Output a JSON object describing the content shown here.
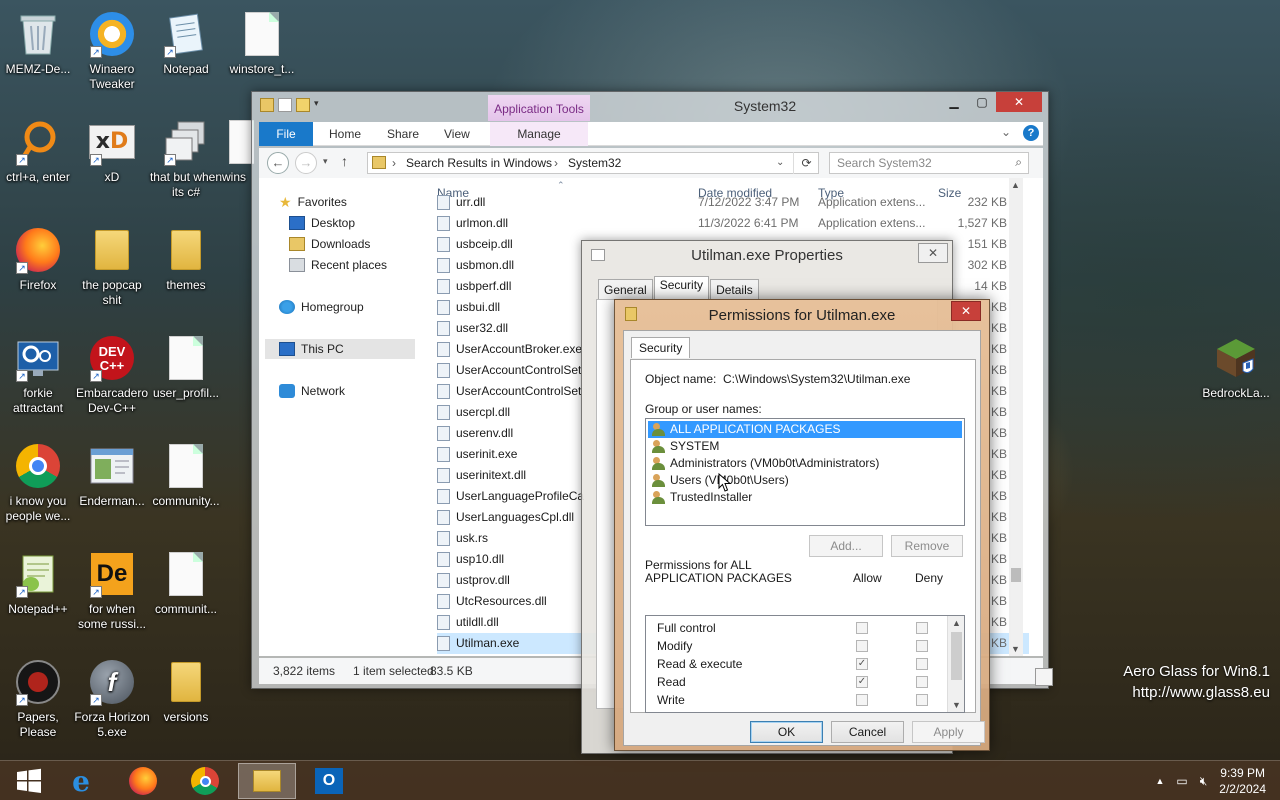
{
  "desktop": {
    "icons": [
      {
        "label": "MEMZ-De...",
        "icon": "recycle-bin-icon"
      },
      {
        "label": "Winaero Tweaker",
        "icon": "winaero-icon"
      },
      {
        "label": "Notepad",
        "icon": "notepad-icon"
      },
      {
        "label": "winstore_t...",
        "icon": "file-icon"
      },
      {
        "label": "ctrl+a, enter",
        "icon": "orange-ring-icon"
      },
      {
        "label": "xD",
        "icon": "xd-icon"
      },
      {
        "label": "that but when its c#",
        "icon": "windows-stack-icon"
      },
      {
        "label": "wins",
        "icon": "file-icon"
      },
      {
        "label": "Firefox",
        "icon": "firefox-icon"
      },
      {
        "label": "the popcap shit",
        "icon": "folder-icon"
      },
      {
        "label": "themes",
        "icon": "folder-icon"
      },
      {
        "label": "forkie attractant",
        "icon": "settings-monitor-icon"
      },
      {
        "label": "Embarcadero Dev-C++",
        "icon": "devcpp-icon"
      },
      {
        "label": "user_profil...",
        "icon": "file-icon"
      },
      {
        "label": "i know you people we...",
        "icon": "chrome-icon"
      },
      {
        "label": "Enderman...",
        "icon": "window-icon"
      },
      {
        "label": "community...",
        "icon": "file-icon"
      },
      {
        "label": "Notepad++",
        "icon": "notepadpp-icon"
      },
      {
        "label": "for when some russi...",
        "icon": "de-icon"
      },
      {
        "label": "communit...",
        "icon": "file-icon"
      },
      {
        "label": "Papers, Please",
        "icon": "papers-please-icon"
      },
      {
        "label": "Forza Horizon 5.exe",
        "icon": "flash-icon"
      },
      {
        "label": "versions",
        "icon": "folder-icon"
      },
      {
        "label": "BedrockLa...",
        "icon": "minecraft-icon"
      }
    ]
  },
  "explorer": {
    "title": "System32",
    "contextual_tab": "Application Tools",
    "tabs": [
      "File",
      "Home",
      "Share",
      "View",
      "Manage"
    ],
    "breadcrumb": [
      "Search Results in Windows",
      "System32"
    ],
    "search_placeholder": "Search System32",
    "nav": {
      "favorites": "Favorites",
      "desktop": "Desktop",
      "downloads": "Downloads",
      "recent": "Recent places",
      "homegroup": "Homegroup",
      "thispc": "This PC",
      "network": "Network"
    },
    "columns": {
      "name": "Name",
      "date": "Date modified",
      "type": "Type",
      "size": "Size"
    },
    "files": [
      {
        "name": "urr.dll",
        "date": "7/12/2022 3:47 PM",
        "type": "Application extens...",
        "size": "232 KB"
      },
      {
        "name": "urlmon.dll",
        "date": "11/3/2022 6:41 PM",
        "type": "Application extens...",
        "size": "1,527 KB"
      },
      {
        "name": "usbceip.dll",
        "date": "",
        "type": "",
        "size": "151 KB"
      },
      {
        "name": "usbmon.dll",
        "date": "",
        "type": "",
        "size": "302 KB"
      },
      {
        "name": "usbperf.dll",
        "date": "",
        "type": "",
        "size": "14 KB"
      },
      {
        "name": "usbui.dll",
        "date": "",
        "type": "",
        "size": "KB"
      },
      {
        "name": "user32.dll",
        "date": "",
        "type": "",
        "size": "KB"
      },
      {
        "name": "UserAccountBroker.exe",
        "date": "",
        "type": "",
        "size": "KB"
      },
      {
        "name": "UserAccountControlSet",
        "date": "",
        "type": "",
        "size": "KB"
      },
      {
        "name": "UserAccountControlSet",
        "date": "",
        "type": "",
        "size": "KB"
      },
      {
        "name": "usercpl.dll",
        "date": "",
        "type": "",
        "size": "KB"
      },
      {
        "name": "userenv.dll",
        "date": "",
        "type": "",
        "size": "KB"
      },
      {
        "name": "userinit.exe",
        "date": "",
        "type": "",
        "size": "KB"
      },
      {
        "name": "userinitext.dll",
        "date": "",
        "type": "",
        "size": "KB"
      },
      {
        "name": "UserLanguageProfileCa",
        "date": "",
        "type": "",
        "size": "KB"
      },
      {
        "name": "UserLanguagesCpl.dll",
        "date": "",
        "type": "",
        "size": "KB"
      },
      {
        "name": "usk.rs",
        "date": "",
        "type": "",
        "size": "KB"
      },
      {
        "name": "usp10.dll",
        "date": "",
        "type": "",
        "size": "KB"
      },
      {
        "name": "ustprov.dll",
        "date": "",
        "type": "",
        "size": "KB"
      },
      {
        "name": "UtcResources.dll",
        "date": "",
        "type": "",
        "size": "KB"
      },
      {
        "name": "utildll.dll",
        "date": "",
        "type": "",
        "size": "KB"
      },
      {
        "name": "Utilman.exe",
        "date": "",
        "type": "",
        "size": "KB"
      }
    ],
    "status": {
      "count": "3,822 items",
      "selected": "1 item selected",
      "size": "83.5 KB"
    }
  },
  "props": {
    "title": "Utilman.exe Properties",
    "tabs": [
      "General",
      "Security",
      "Details"
    ]
  },
  "perms": {
    "title": "Permissions for Utilman.exe",
    "tab": "Security",
    "object_label": "Object name:",
    "object_value": "C:\\Windows\\System32\\Utilman.exe",
    "group_label": "Group or user names:",
    "groups": [
      "ALL APPLICATION PACKAGES",
      "SYSTEM",
      "Administrators (VM0b0t\\Administrators)",
      "Users (VM0b0t\\Users)",
      "TrustedInstaller"
    ],
    "add_label": "Add...",
    "remove_label": "Remove",
    "perm_label_1": "Permissions for ALL",
    "perm_label_2": "APPLICATION PACKAGES",
    "allow_label": "Allow",
    "deny_label": "Deny",
    "permissions": [
      {
        "name": "Full control",
        "allow": false,
        "deny": false
      },
      {
        "name": "Modify",
        "allow": false,
        "deny": false
      },
      {
        "name": "Read & execute",
        "allow": true,
        "deny": false
      },
      {
        "name": "Read",
        "allow": true,
        "deny": false
      },
      {
        "name": "Write",
        "allow": false,
        "deny": false
      }
    ],
    "ok_label": "OK",
    "cancel_label": "Cancel",
    "apply_label": "Apply"
  },
  "watermark": {
    "line1": "Aero Glass for Win8.1",
    "line2": "http://www.glass8.eu"
  },
  "taskbar": {
    "apps": [
      "start-icon",
      "internet-explorer-icon",
      "firefox-icon",
      "chrome-icon",
      "file-explorer-icon",
      "outlook-icon"
    ],
    "time": "9:39 PM",
    "date": "2/2/2024"
  },
  "colors": {
    "accent": "#1979ca",
    "selection": "#3399ff",
    "contextual_tab": "#7a2b85"
  }
}
